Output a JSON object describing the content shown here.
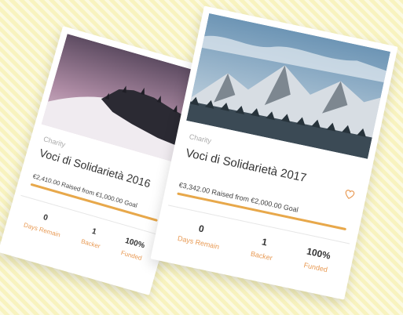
{
  "colors": {
    "accent": "#e8a84a",
    "label": "#e89a54"
  },
  "cards": [
    {
      "category": "Charity",
      "title": "Voci di Solidarietà 2016",
      "raised_text": "€2,410.00 Raised from €1,000.00 Goal",
      "progress": 1.0,
      "stats": [
        {
          "value": "0",
          "label": "Days Remain"
        },
        {
          "value": "1",
          "label": "Backer"
        },
        {
          "value": "100%",
          "label": "Funded"
        }
      ]
    },
    {
      "category": "Charity",
      "title": "Voci di Solidarietà 2017",
      "raised_text": "€3,342.00 Raised from €2,000.00 Goal",
      "progress": 1.0,
      "favorite_icon": "heart-icon",
      "stats": [
        {
          "value": "0",
          "label": "Days Remain"
        },
        {
          "value": "1",
          "label": "Backer"
        },
        {
          "value": "100%",
          "label": "Funded"
        }
      ]
    }
  ]
}
